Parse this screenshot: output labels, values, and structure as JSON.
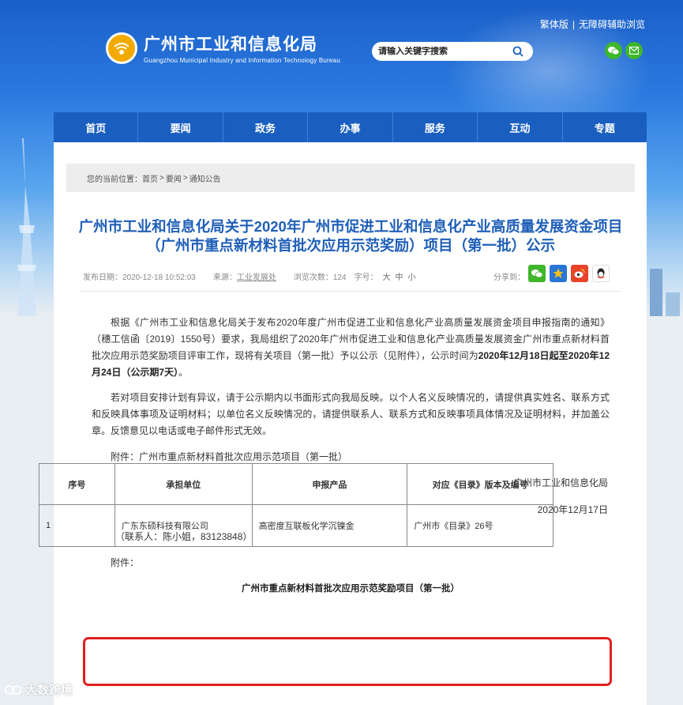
{
  "header": {
    "logo_cn": "广州市工业和信息化局",
    "logo_en": "Guangzhou Municipal Industry and Information Technology Bureau",
    "top_links": [
      "繁体版",
      "无障碍辅助浏览"
    ],
    "search_placeholder": "请输入关键字搜索"
  },
  "nav": [
    "首页",
    "要闻",
    "政务",
    "办事",
    "服务",
    "互动",
    "专题"
  ],
  "breadcrumb": {
    "label": "您的当前位置：",
    "items": [
      "首页",
      "要闻",
      "通知公告"
    ]
  },
  "article": {
    "title": "广州市工业和信息化局关于2020年广州市促进工业和信息化产业高质量发展资金项目（广州市重点新材料首批次应用示范奖励）项目（第一批）公示",
    "meta": {
      "date_label": "发布日期：",
      "date": "2020-12-18 10:52:03",
      "source_label": "来源：",
      "source": "工业发展处",
      "views_label": "浏览次数：",
      "views": "124",
      "font_label": "字号：",
      "sizes": [
        "大",
        "中",
        "小"
      ],
      "share_label": "分享到："
    },
    "p1_a": "根据《广州市工业和信息化局关于发布2020年度广州市促进工业和信息化产业高质量发展资金项目申报指南的通知》（穗工信函〔2019〕1550号）要求，我局组织了2020年广州市促进工业和信息化产业高质量发展资金广州市重点新材料首批次应用示范奖励项目评审工作，现将有关项目（第一批）予以公示（见附件），公示时间为",
    "p1_b": "2020年12月18日起至2020年12月24日（公示期7天）",
    "p1_c": "。",
    "p2": "若对项目安排计划有异议，请于公示期内以书面形式向我局反映。以个人名义反映情况的，请提供真实姓名、联系方式和反映具体事项及证明材料；以单位名义反映情况的，请提供联系人、联系方式和反映事项具体情况及证明材料，并加盖公章。反馈意见以电话或电子邮件形式无效。",
    "p3": "附件：广州市重点新材料首批次应用示范项目（第一批）",
    "sign_org": "广州市工业和信息化局",
    "sign_date": "2020年12月17日",
    "contact": "（联系人：陈小姐，83123848）",
    "attach_label": "附件：",
    "table_title": "广州市重点新材料首批次应用示范奖励项目（第一批）"
  },
  "table": {
    "headers": [
      "序号",
      "承担单位",
      "申报产品",
      "对应《目录》版本及编号"
    ],
    "rows": [
      [
        "1",
        "广东东硕科技有限公司",
        "高密度互联板化学沉镍金",
        "广州市《目录》26号"
      ]
    ]
  },
  "watermark": "大数跨境"
}
